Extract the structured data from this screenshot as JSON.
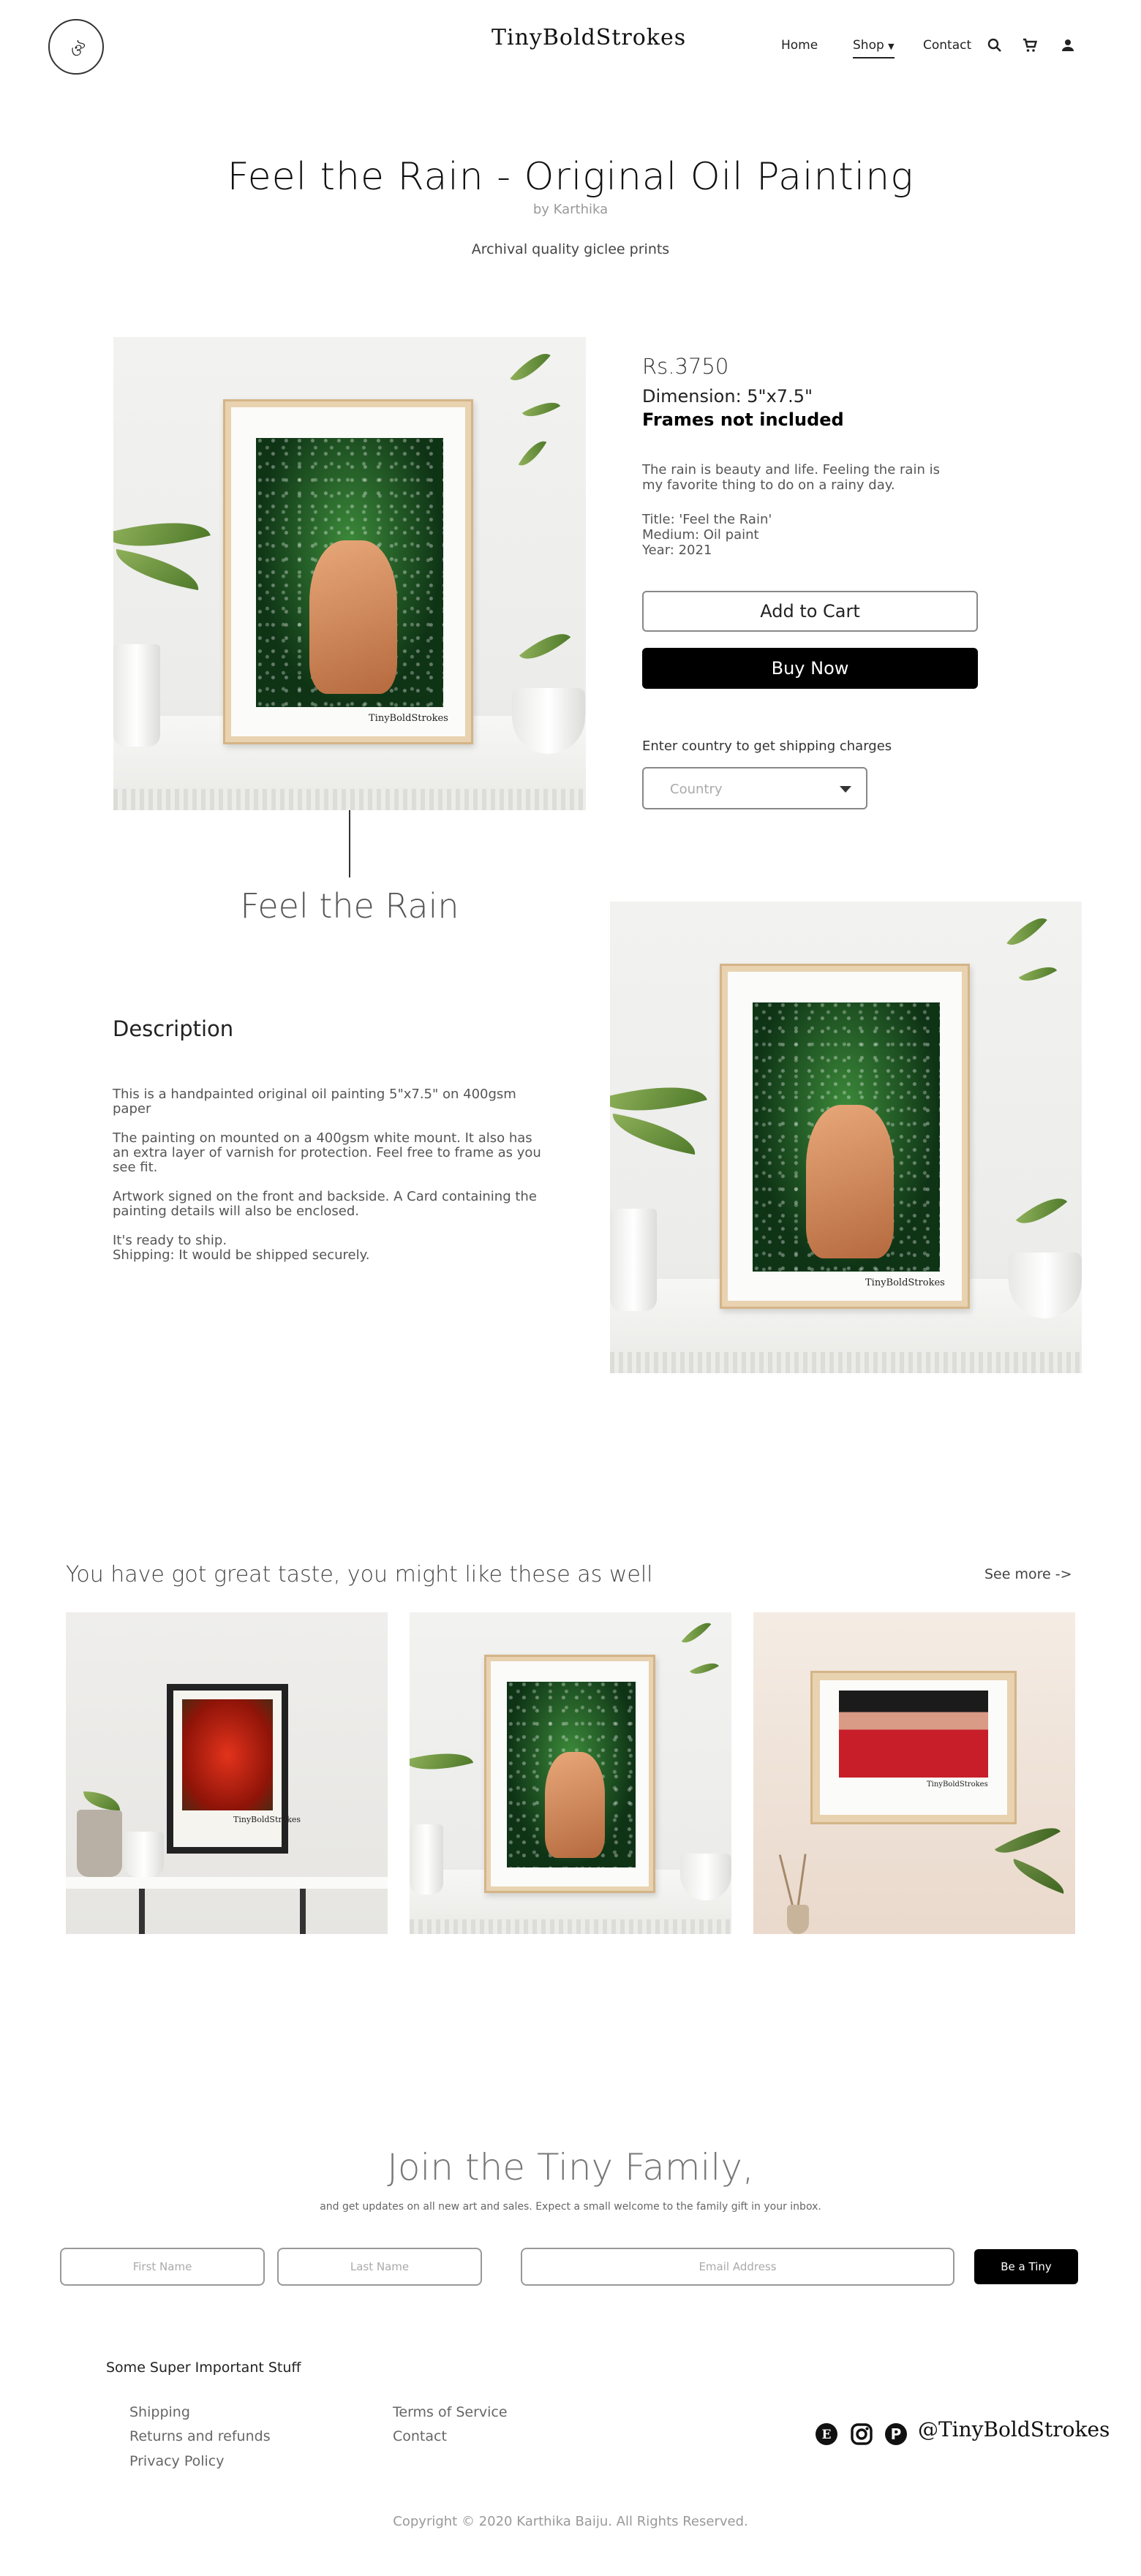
{
  "header": {
    "logo_text": "ঔ",
    "brand": "TinyBoldStrokes",
    "nav": {
      "home": "Home",
      "shop": "Shop",
      "contact": "Contact"
    },
    "icons": [
      "search-icon",
      "cart-icon",
      "account-icon"
    ]
  },
  "product": {
    "title": "Feel the Rain - Original Oil Painting",
    "by": "by Karthika",
    "print_note": "Archival quality giclee prints",
    "price": "Rs.3750",
    "dimension": "Dimension: 5\"x7.5\"",
    "frames_note": "Frames not included",
    "blurb": "The rain is beauty and life. Feeling the rain is my favorite thing to do on a rainy day.",
    "meta": {
      "title": "Title: 'Feel the Rain'",
      "medium": "Medium: Oil paint",
      "year": "Year: 2021"
    },
    "add_to_cart": "Add to Cart",
    "buy_now": "Buy Now",
    "shipping_label": "Enter country to get shipping charges",
    "country_placeholder": "Country",
    "art_signature": "TinyBoldStrokes",
    "section_label": "Feel the Rain"
  },
  "description": {
    "heading": "Description",
    "paragraphs": [
      "This is a handpainted original oil painting 5\"x7.5\" on 400gsm paper",
      "The painting on mounted on a 400gsm white mount. It also has an extra layer of varnish for protection. Feel free to frame as you see fit.",
      "Artwork signed on the front and backside. A Card containing the painting details will also be enclosed.",
      "It's ready to ship.",
      "Shipping: It would be shipped securely."
    ]
  },
  "recommendations": {
    "title": "You have got great taste, you might like these as well",
    "see_more": "See more ->"
  },
  "newsletter": {
    "title": "Join the Tiny Family,",
    "subtitle": "and get updates on all new art and sales. Expect a small welcome to the family gift in your inbox.",
    "first_name": "First Name",
    "last_name": "Last Name",
    "email": "Email Address",
    "submit": "Be a Tiny"
  },
  "footer": {
    "heading": "Some Super Important Stuff",
    "links_left": [
      "Shipping",
      "Returns and refunds",
      "Privacy Policy"
    ],
    "links_right": [
      "Terms of Service",
      "Contact"
    ],
    "social_icons": [
      "etsy-icon",
      "instagram-icon",
      "pinterest-icon"
    ],
    "handle": "@TinyBoldStrokes",
    "copyright": "Copyright © 2020 Karthika Baiju. All Rights Reserved."
  },
  "colors": {
    "accent": "#000000",
    "text": "#222222",
    "muted": "#999999"
  }
}
